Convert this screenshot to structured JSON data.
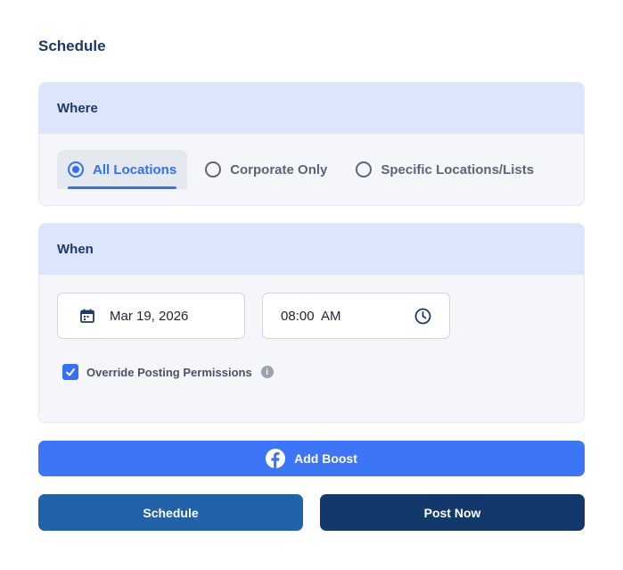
{
  "title": "Schedule",
  "where": {
    "header": "Where",
    "options": [
      {
        "label": "All Locations",
        "selected": true
      },
      {
        "label": "Corporate Only",
        "selected": false
      },
      {
        "label": "Specific Locations/Lists",
        "selected": false
      }
    ]
  },
  "when": {
    "header": "When",
    "date": "Mar 19, 2026",
    "time": "08:00  AM",
    "override_label": "Override Posting Permissions",
    "override_checked": true
  },
  "buttons": {
    "add_boost": "Add Boost",
    "schedule": "Schedule",
    "post_now": "Post Now"
  },
  "colors": {
    "accent": "#3470f5",
    "header_bg": "#dbe5fb",
    "schedule_btn": "#2162a8",
    "post_now_btn": "#13386b"
  }
}
